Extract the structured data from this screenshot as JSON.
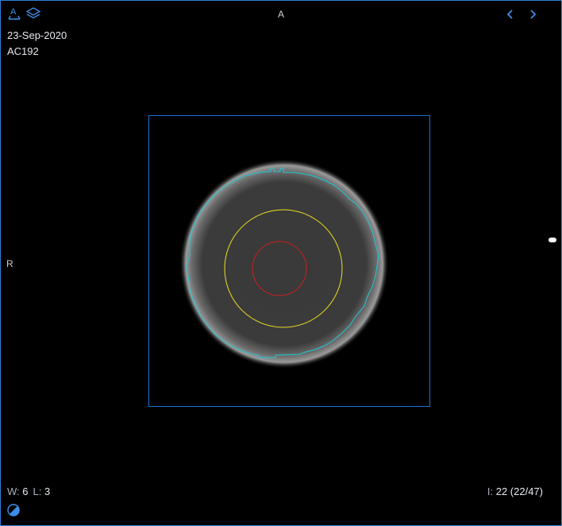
{
  "viewport": {
    "study_date": "23-Sep-2020",
    "patient_id": "AC192",
    "orientation_top": "A",
    "orientation_left": "R",
    "window_label": "W:",
    "window_value": "6",
    "level_label": "L:",
    "level_value": "3",
    "image_label": "I:",
    "image_value": "22 (22/47)"
  },
  "icons": {
    "tool": "annotation-tool-icon",
    "layers": "layers-icon",
    "prev": "chevron-left-icon",
    "next": "chevron-right-icon",
    "window_level": "contrast-icon"
  },
  "colors": {
    "accent": "#3b8fe8",
    "roi_outer": "#1ec8d6",
    "roi_mid": "#f0e020",
    "roi_inner": "#d21c1c",
    "bounding_box": "#1f6fd4"
  }
}
